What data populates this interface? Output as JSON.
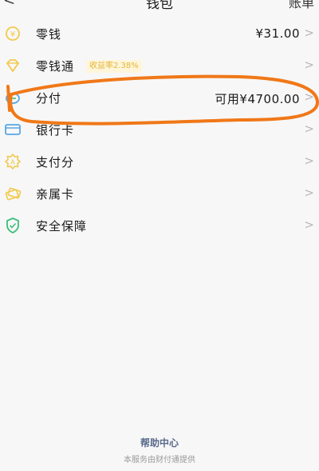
{
  "nav": {
    "back_icon": "chevron-left-icon",
    "title": "钱包",
    "bill_label": "账单"
  },
  "items": [
    {
      "label": "零钱",
      "value": "¥31.00",
      "icon": "coin-icon"
    },
    {
      "label": "零钱通",
      "badge": "收益率2.38%",
      "icon": "diamond-icon"
    },
    {
      "label": "分付",
      "value": "可用¥4700.00",
      "icon": "fenfu-icon"
    },
    {
      "label": "银行卡",
      "icon": "bank-card-icon"
    },
    {
      "label": "支付分",
      "icon": "badge-star-icon"
    },
    {
      "label": "亲属卡",
      "icon": "family-card-icon"
    },
    {
      "label": "安全保障",
      "icon": "shield-check-icon"
    }
  ],
  "footer": {
    "help_label": "帮助中心",
    "provider_text": "本服务由财付通提供"
  },
  "colors": {
    "icon_yellow": "#f2c94c",
    "icon_blue": "#58a6e6",
    "icon_green": "#3cbf7b",
    "annotation_orange": "#f07818",
    "chevron_gray": "#b8b8b8"
  }
}
